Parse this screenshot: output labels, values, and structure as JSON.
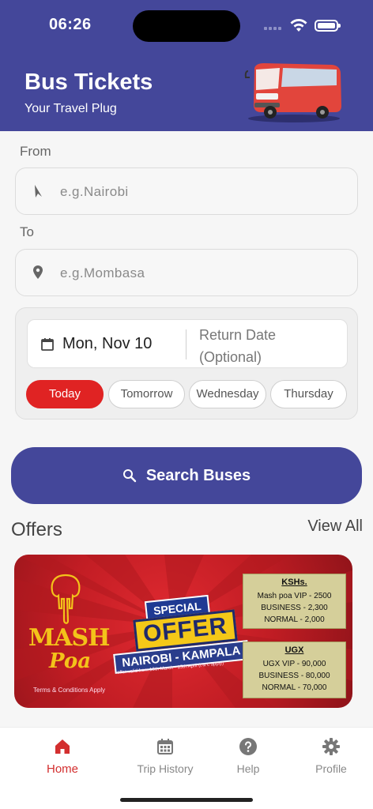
{
  "status": {
    "time": "06:26"
  },
  "header": {
    "title": "Bus Tickets",
    "subtitle": "Your Travel Plug"
  },
  "form": {
    "from_label": "From",
    "from_placeholder": "e.g.Nairobi",
    "to_label": "To",
    "to_placeholder": "e.g.Mombasa",
    "departure_date": "Mon, Nov 10",
    "return_date_label": "Return Date (Optional)",
    "quick_days": [
      "Today",
      "Tomorrow",
      "Wednesday",
      "Thursday"
    ],
    "selected_day": "Today"
  },
  "search_button": {
    "label": "Search Buses"
  },
  "offers": {
    "title": "Offers",
    "view_all": "View All",
    "banner": {
      "brand_line1": "MASH",
      "brand_line2": "Poa",
      "terms": "Terms & Conditions Apply",
      "special": "SPECIAL",
      "offer": "OFFER",
      "route": "NAIROBI - KAMPALA",
      "validity": "offer valid from 19th March - 15th April (t & c apply)",
      "prices_ksh": {
        "heading": "KSHs.",
        "rows": [
          "Mash poa VIP - 2500",
          "BUSINESS - 2,300",
          "NORMAL - 2,000"
        ]
      },
      "prices_ugx": {
        "heading": "UGX",
        "rows": [
          "UGX VIP - 90,000",
          "BUSINESS - 80,000",
          "NORMAL - 70,000"
        ]
      }
    }
  },
  "tabbar": {
    "home": "Home",
    "trip_history": "Trip History",
    "help": "Help",
    "profile": "Profile",
    "active": "Home"
  },
  "colors": {
    "primary": "#44479a",
    "accent_red": "#e02323",
    "active_tab": "#d32f2f"
  }
}
